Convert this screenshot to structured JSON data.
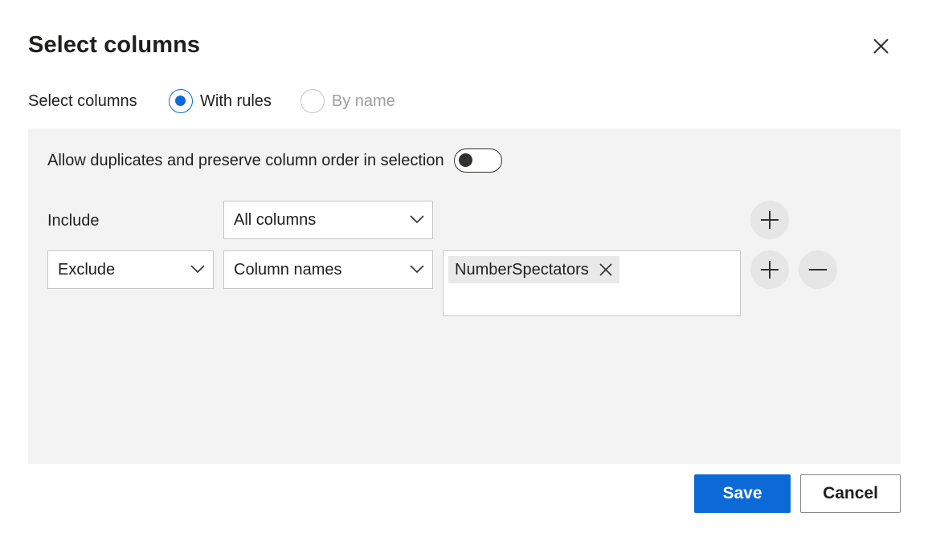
{
  "dialog": {
    "title": "Select columns"
  },
  "mode": {
    "label": "Select columns",
    "options": [
      {
        "label": "With rules",
        "selected": true,
        "disabled": false
      },
      {
        "label": "By name",
        "selected": false,
        "disabled": true
      }
    ]
  },
  "panel": {
    "toggle_label": "Allow duplicates and preserve column order in selection",
    "toggle_on": false,
    "rules": [
      {
        "type": "Include",
        "selector": "All columns",
        "tags": []
      },
      {
        "type": "Exclude",
        "selector": "Column names",
        "tags": [
          "NumberSpectators"
        ]
      }
    ]
  },
  "footer": {
    "save_label": "Save",
    "cancel_label": "Cancel"
  },
  "colors": {
    "accent": "#0b6ad6",
    "panel_bg": "#f3f3f3"
  },
  "icons": {
    "close": "close-icon",
    "chevron": "chevron-down-icon",
    "add": "plus-icon",
    "remove": "minus-icon"
  }
}
